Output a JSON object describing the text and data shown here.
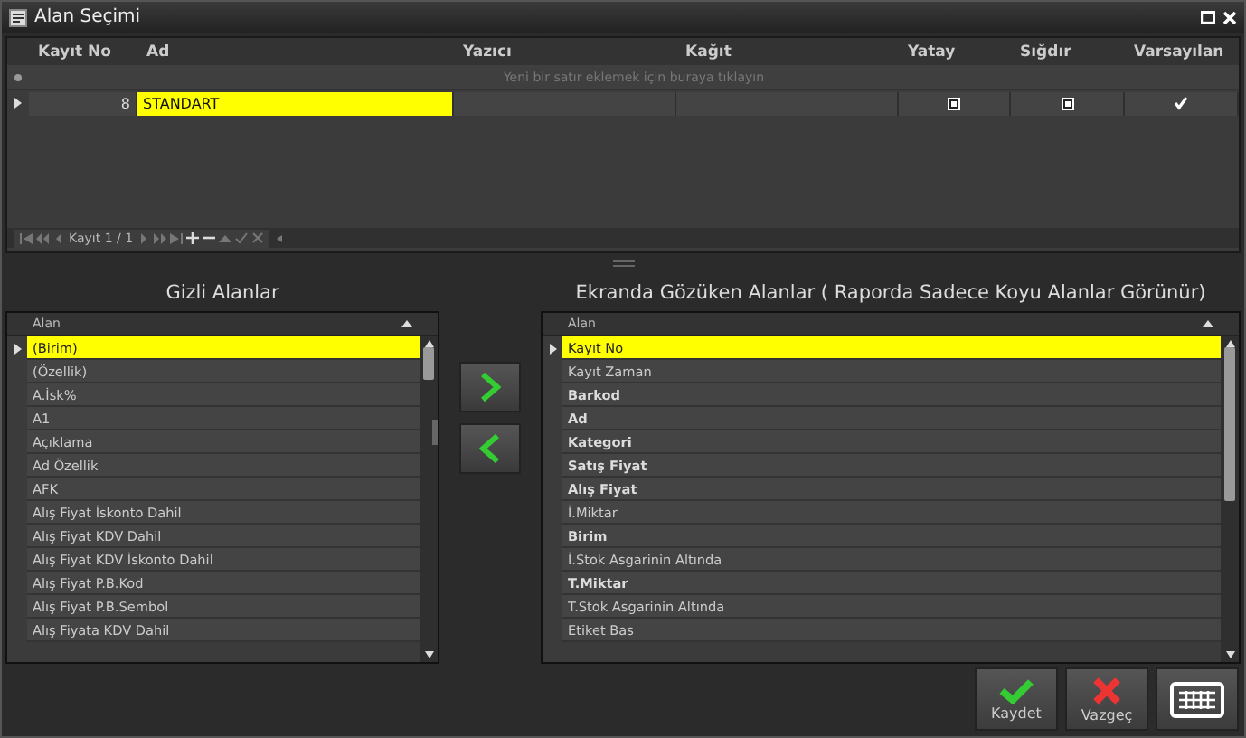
{
  "window": {
    "title": "Alan Seçimi"
  },
  "grid": {
    "columns": [
      "Kayıt No",
      "Ad",
      "Yazıcı",
      "Kağıt",
      "Yatay",
      "Sığdır",
      "Varsayılan"
    ],
    "new_row_placeholder": "Yeni bir satır eklemek için buraya tıklayın",
    "rows": [
      {
        "kayit_no": "8",
        "ad": "STANDART",
        "yatay": false,
        "sigdir": false,
        "varsayilan": true,
        "selected": true
      }
    ]
  },
  "navigator": {
    "label": "Kayıt 1 / 1"
  },
  "hidden_fields": {
    "title": "Gizli Alanlar",
    "column": "Alan",
    "items": [
      {
        "label": "(Birim)",
        "selected": true
      },
      {
        "label": "(Özellik)",
        "selected": false
      },
      {
        "label": "A.İsk%",
        "selected": false
      },
      {
        "label": "A1",
        "selected": false
      },
      {
        "label": "Açıklama",
        "selected": false
      },
      {
        "label": "Ad Özellik",
        "selected": false
      },
      {
        "label": "AFK",
        "selected": false
      },
      {
        "label": "Alış Fiyat İskonto Dahil",
        "selected": false
      },
      {
        "label": "Alış Fiyat KDV Dahil",
        "selected": false
      },
      {
        "label": "Alış Fiyat KDV İskonto Dahil",
        "selected": false
      },
      {
        "label": "Alış Fiyat P.B.Kod",
        "selected": false
      },
      {
        "label": "Alış Fiyat P.B.Sembol",
        "selected": false
      },
      {
        "label": "Alış Fiyata KDV Dahil",
        "selected": false
      }
    ]
  },
  "visible_fields": {
    "title": "Ekranda Gözüken Alanlar ( Raporda Sadece Koyu Alanlar Görünür)",
    "column": "Alan",
    "items": [
      {
        "label": "Kayıt No",
        "selected": true,
        "bold": false
      },
      {
        "label": "Kayıt Zaman",
        "selected": false,
        "bold": false
      },
      {
        "label": "Barkod",
        "selected": false,
        "bold": true
      },
      {
        "label": "Ad",
        "selected": false,
        "bold": true
      },
      {
        "label": "Kategori",
        "selected": false,
        "bold": true
      },
      {
        "label": "Satış Fiyat",
        "selected": false,
        "bold": true
      },
      {
        "label": "Alış Fiyat",
        "selected": false,
        "bold": true
      },
      {
        "label": "İ.Miktar",
        "selected": false,
        "bold": false
      },
      {
        "label": "Birim",
        "selected": false,
        "bold": true
      },
      {
        "label": "İ.Stok Asgarinin Altında",
        "selected": false,
        "bold": false
      },
      {
        "label": "T.Miktar",
        "selected": false,
        "bold": true
      },
      {
        "label": "T.Stok Asgarinin Altında",
        "selected": false,
        "bold": false
      },
      {
        "label": "Etiket Bas",
        "selected": false,
        "bold": false
      }
    ]
  },
  "buttons": [
    {
      "kind": "save",
      "label": "Kaydet"
    },
    {
      "kind": "cancel",
      "label": "Vazgeç"
    },
    {
      "kind": "keyboard"
    }
  ]
}
